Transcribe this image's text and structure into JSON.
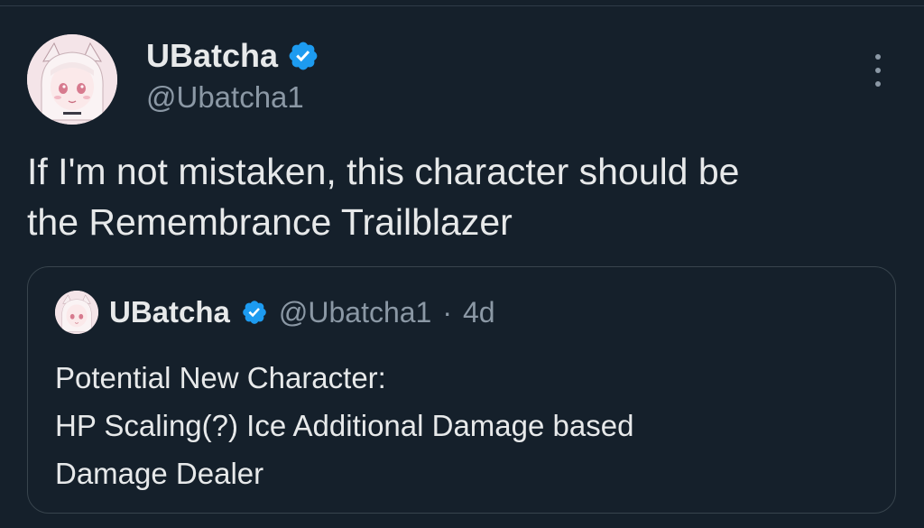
{
  "tweet": {
    "display_name": "UBatcha",
    "handle": "@Ubatcha1",
    "text_line_1": "If I'm not mistaken, this character should be",
    "text_line_2": "the Remembrance Trailblazer"
  },
  "quoted_tweet": {
    "display_name": "UBatcha",
    "handle": "@Ubatcha1",
    "separator": "·",
    "time": "4d",
    "lines": [
      "Potential New Character:",
      "HP Scaling(?) Ice Additional Damage based",
      "Damage Dealer"
    ]
  },
  "icons": {
    "verified": "verified-badge-icon",
    "more": "more-options-icon",
    "avatar": "avatar-anime-girl"
  },
  "colors": {
    "background": "#15202b",
    "text_primary": "#e7e9ea",
    "text_secondary": "#8b98a5",
    "verified_blue": "#1d9bf0",
    "border": "#38444d"
  }
}
